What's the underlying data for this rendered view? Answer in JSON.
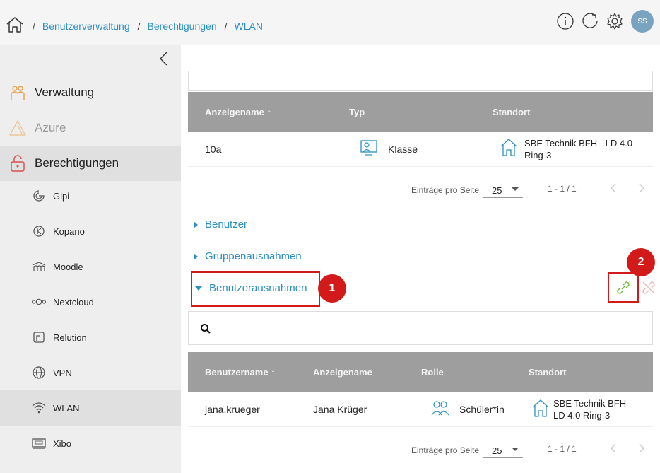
{
  "breadcrumb": {
    "sep": "/",
    "items": [
      "Benutzerverwaltung",
      "Berechtigungen",
      "WLAN"
    ]
  },
  "user": {
    "initials": "SS"
  },
  "sidebar": {
    "items": [
      {
        "label": "Verwaltung",
        "icon": "admin-users-icon"
      },
      {
        "label": "Azure",
        "icon": "azure-icon"
      },
      {
        "label": "Berechtigungen",
        "icon": "lock-icon"
      }
    ],
    "sub_items": [
      {
        "label": "Glpi",
        "icon": "glpi-icon"
      },
      {
        "label": "Kopano",
        "icon": "kopano-icon"
      },
      {
        "label": "Moodle",
        "icon": "moodle-icon"
      },
      {
        "label": "Nextcloud",
        "icon": "nextcloud-icon"
      },
      {
        "label": "Relution",
        "icon": "relution-icon"
      },
      {
        "label": "VPN",
        "icon": "globe-icon"
      },
      {
        "label": "WLAN",
        "icon": "wifi-icon"
      },
      {
        "label": "Xibo",
        "icon": "xibo-icon"
      }
    ]
  },
  "groups_table": {
    "headers": [
      "Anzeigename",
      "Typ",
      "Standort"
    ],
    "sort_indicator": "↑",
    "rows": [
      {
        "name": "10a",
        "type": "Klasse",
        "location_line1": "SBE Technik BFH - LD 4.0",
        "location_line2": "Ring-3"
      }
    ],
    "pager": {
      "label": "Einträge pro Seite",
      "per_page": "25",
      "range": "1 - 1 / 1"
    }
  },
  "sections": {
    "users": "Benutzer",
    "group_exceptions": "Gruppenausnahmen",
    "user_exceptions": "Benutzerausnahmen"
  },
  "badges": {
    "one": "1",
    "two": "2"
  },
  "search": {
    "placeholder": "",
    "value": ""
  },
  "users_table": {
    "headers": [
      "Benutzername",
      "Anzeigename",
      "Rolle",
      "Standort"
    ],
    "sort_indicator": "↑",
    "rows": [
      {
        "username": "jana.krueger",
        "display": "Jana Krüger",
        "role": "Schüler*in",
        "location_line1": "SBE Technik BFH -",
        "location_line2": "LD 4.0 Ring-3"
      }
    ],
    "pager": {
      "label": "Einträge pro Seite",
      "per_page": "25",
      "range": "1 - 1 / 1"
    }
  },
  "colors": {
    "accent": "#2b8fc4",
    "highlight": "#d21a1a",
    "header_bg": "#9e9e9e",
    "link_green": "#6cbf3a"
  }
}
